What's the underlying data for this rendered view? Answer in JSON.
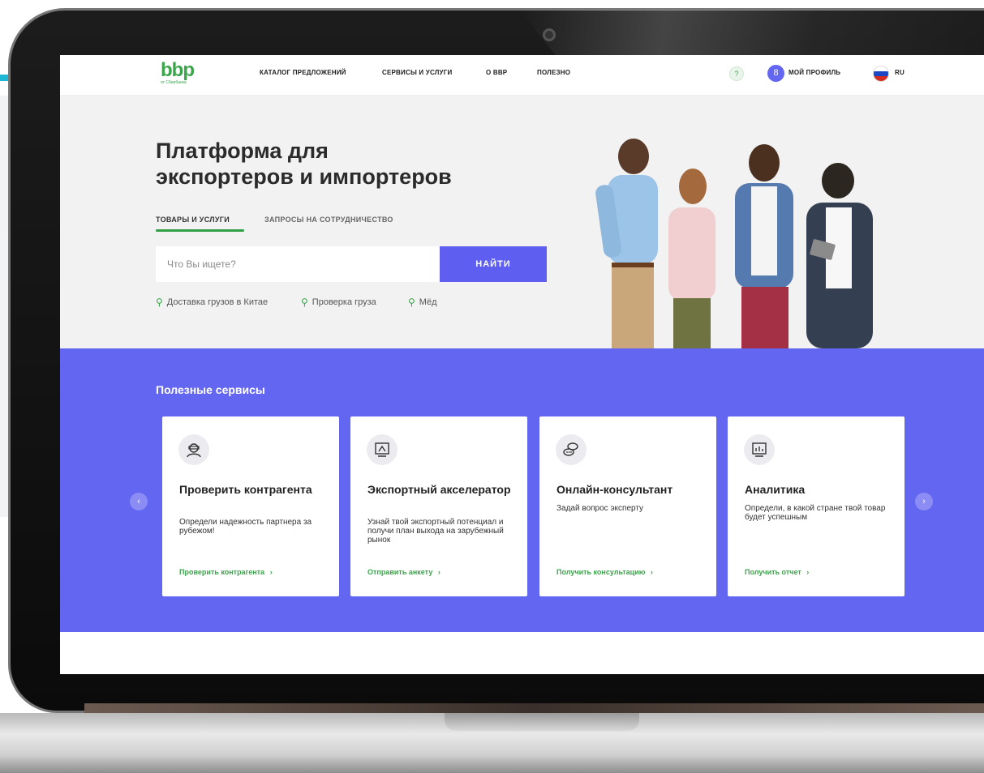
{
  "header": {
    "logo_text": "bbp",
    "logo_sub": "от Сбербанка",
    "nav": [
      "КАТАЛОГ ПРЕДЛОЖЕНИЙ",
      "СЕРВИСЫ И УСЛУГИ",
      "О ВВР",
      "ПОЛЕЗНО"
    ],
    "profile_label": "МОЙ ПРОФИЛЬ",
    "avatar_letter": "8",
    "lang": "RU",
    "help_glyph": "?"
  },
  "hero": {
    "title_line1": "Платформа для",
    "title_line2": "экспортеров и импортеров",
    "tabs": [
      "ТОВАРЫ И УСЛУГИ",
      "ЗАПРОСЫ НА СОТРУДНИЧЕСТВО"
    ],
    "search_placeholder": "Что Вы ищете?",
    "search_button": "НАЙТИ",
    "suggestions": [
      "Доставка грузов в Китае",
      "Проверка груза",
      "Мёд"
    ]
  },
  "services": {
    "title": "Полезные сервисы",
    "cards": [
      {
        "title": "Проверить контрагента",
        "desc": "Определи надежность партнера за рубежом!",
        "link": "Проверить контрагента",
        "icon": "inspector-icon"
      },
      {
        "title": "Экспортный акселератор",
        "desc": "Узнай твой экспортный потенциал и получи план выхода на зарубежный рынок",
        "link": "Отправить анкету",
        "icon": "presentation-icon"
      },
      {
        "title": "Онлайн-консультант",
        "desc": "Задай вопрос эксперту",
        "link": "Получить консультацию",
        "icon": "chat-icon"
      },
      {
        "title": "Аналитика",
        "desc": "Определи, в какой стране твой товар будет успешным",
        "link": "Получить отчет",
        "icon": "analytics-icon"
      }
    ],
    "link_arrow": "›"
  },
  "colors": {
    "accent": "#6366f1",
    "green": "#3aa54a",
    "hero_bg": "#f2f2f2"
  }
}
